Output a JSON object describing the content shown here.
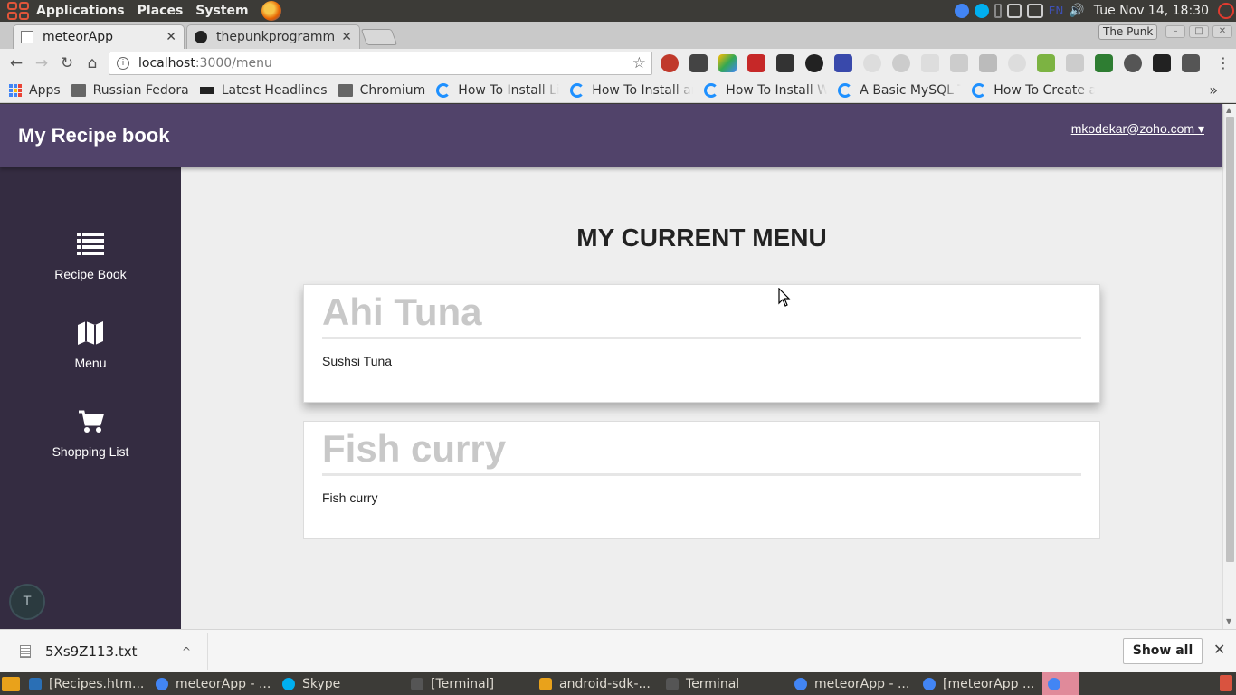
{
  "top_panel": {
    "menus": [
      "Applications",
      "Places",
      "System"
    ],
    "clock": "Tue Nov 14, 18:30",
    "keyboard_layout": "EN"
  },
  "tabs": [
    {
      "title": "meteorApp",
      "active": true
    },
    {
      "title": "thepunkprogramm",
      "active": false
    }
  ],
  "profile_name": "The Punk",
  "omnibox": {
    "host": "localhost",
    "path": ":3000/menu"
  },
  "bookmarks": [
    {
      "label": "Apps",
      "icon": "apps-grid-icon"
    },
    {
      "label": "Russian Fedora",
      "icon": "folder-icon"
    },
    {
      "label": "Latest Headlines",
      "icon": "bbc-icon"
    },
    {
      "label": "Chromium",
      "icon": "folder-icon"
    },
    {
      "label": "How To Install Li",
      "icon": "digitalocean-icon"
    },
    {
      "label": "How To Install ar",
      "icon": "digitalocean-icon"
    },
    {
      "label": "How To Install W",
      "icon": "digitalocean-icon"
    },
    {
      "label": "A Basic MySQL T",
      "icon": "digitalocean-icon"
    },
    {
      "label": "How To Create a",
      "icon": "digitalocean-icon"
    }
  ],
  "app": {
    "title": "My Recipe book",
    "user": "mkodekar@zoho.com ▾",
    "accent": "#51436a",
    "sidebar_bg": "#342c41",
    "sidebar": [
      {
        "label": "Recipe Book",
        "icon": "list-icon"
      },
      {
        "label": "Menu",
        "icon": "map-icon"
      },
      {
        "label": "Shopping List",
        "icon": "cart-icon"
      }
    ],
    "avatar_letter": "T",
    "page_title": "MY CURRENT MENU",
    "menu_items": [
      {
        "name": "Ahi Tuna",
        "description": "Sushsi Tuna"
      },
      {
        "name": "Fish curry",
        "description": "Fish curry"
      }
    ]
  },
  "download": {
    "filename": "5Xs9Z113.txt",
    "show_all": "Show all"
  },
  "taskbar": [
    {
      "label": "[Recipes.htm...",
      "icon": "vscode-icon"
    },
    {
      "label": "meteorApp - ...",
      "icon": "chrome-icon"
    },
    {
      "label": "Skype",
      "icon": "skype-icon"
    },
    {
      "label": "[Terminal]",
      "icon": "terminal-icon"
    },
    {
      "label": "android-sdk-...",
      "icon": "folder-icon"
    },
    {
      "label": "Terminal",
      "icon": "terminal-icon"
    },
    {
      "label": "meteorApp - ...",
      "icon": "chrome-icon"
    },
    {
      "label": "[meteorApp ...",
      "icon": "chrome-icon"
    }
  ]
}
